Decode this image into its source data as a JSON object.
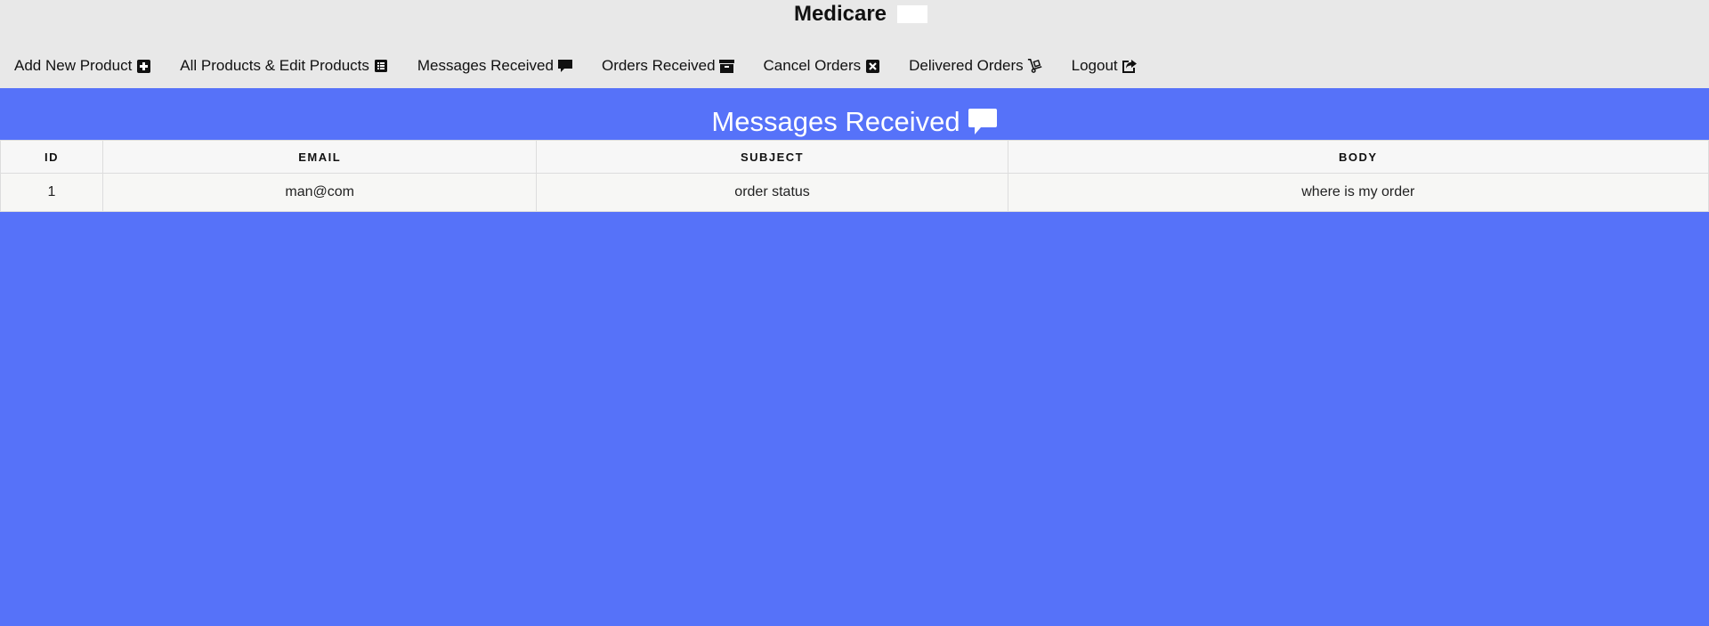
{
  "header": {
    "title": "Medicare"
  },
  "nav": {
    "items": [
      {
        "label": "Add New Product",
        "icon": "plus-square-icon"
      },
      {
        "label": "All Products & Edit Products",
        "icon": "list-alt-icon"
      },
      {
        "label": "Messages Received",
        "icon": "comment-icon"
      },
      {
        "label": "Orders Received",
        "icon": "archive-icon"
      },
      {
        "label": "Cancel Orders",
        "icon": "close-square-icon"
      },
      {
        "label": "Delivered Orders",
        "icon": "hand-truck-icon"
      },
      {
        "label": "Logout",
        "icon": "share-square-icon"
      }
    ]
  },
  "main": {
    "title": "Messages Received",
    "title_icon": "comment-icon",
    "table": {
      "columns": [
        "ID",
        "EMAIL",
        "SUBJECT",
        "BODY"
      ],
      "rows": [
        [
          "1",
          "man@com",
          "order status",
          "where is my order"
        ]
      ]
    }
  },
  "colors": {
    "background": "#5672f9",
    "topbar": "#e8e8e8",
    "table": "#f7f7f7"
  }
}
